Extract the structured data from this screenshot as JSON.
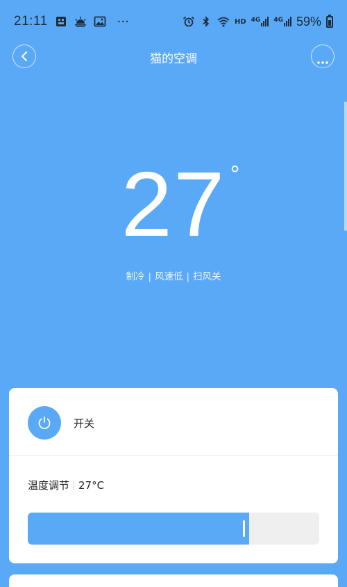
{
  "status_bar": {
    "time": "21:11",
    "notification_icons": [
      "sim-card-icon",
      "weather-sunrise-icon",
      "image-icon"
    ],
    "more_label": "···",
    "right_icons": [
      "alarm-icon",
      "bluetooth-icon",
      "wifi-icon"
    ],
    "hd_label": "HD",
    "network_1": "4G",
    "network_2": "4G",
    "battery_text": "59%",
    "battery_level": 0.59
  },
  "nav": {
    "title": "猫的空调",
    "back_icon": "chevron-left-icon",
    "more_icon": "ellipsis-icon"
  },
  "display": {
    "temperature": "27",
    "degree_symbol": "°",
    "mode": "制冷",
    "fan": "风速低",
    "swing": "扫风关",
    "separator": "|"
  },
  "controls": {
    "power_label": "开关",
    "power_icon": "power-icon",
    "temp_label": "温度调节",
    "temp_value": "27°C",
    "slider_level": 0.76
  },
  "colors": {
    "accent": "#5aa9f7",
    "card_bg": "#ffffff",
    "track_bg": "#efefef"
  }
}
